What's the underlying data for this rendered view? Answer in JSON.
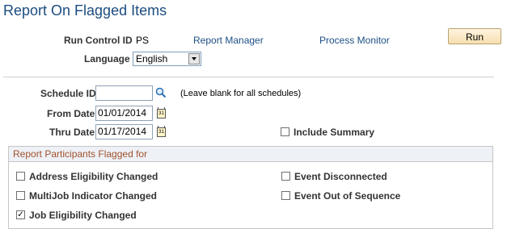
{
  "page": {
    "title": "Report On Flagged Items"
  },
  "run_control": {
    "label": "Run Control ID",
    "value": "PS",
    "report_manager": "Report Manager",
    "process_monitor": "Process Monitor",
    "run_button": "Run"
  },
  "language": {
    "label": "Language",
    "selected": "English"
  },
  "schedule": {
    "label": "Schedule ID",
    "value": "",
    "hint": "(Leave blank for all schedules)"
  },
  "from_date": {
    "label": "From Date",
    "value": "01/01/2014"
  },
  "thru_date": {
    "label": "Thru Date",
    "value": "01/17/2014"
  },
  "include_summary": {
    "label": "Include Summary",
    "checked": false
  },
  "participants": {
    "header": "Report Participants Flagged for",
    "address": {
      "label": "Address Eligibility Changed",
      "checked": false
    },
    "multijob": {
      "label": "MultiJob Indicator Changed",
      "checked": false
    },
    "job": {
      "label": "Job Eligibility Changed",
      "checked": true,
      "mark": "✓"
    },
    "disconnected": {
      "label": "Event Disconnected",
      "checked": false
    },
    "out_of_sequence": {
      "label": "Event Out of Sequence",
      "checked": false
    }
  },
  "icons": {
    "lookup": "magnifier-icon",
    "calendar": "calendar-icon",
    "calendar_text": "31"
  }
}
